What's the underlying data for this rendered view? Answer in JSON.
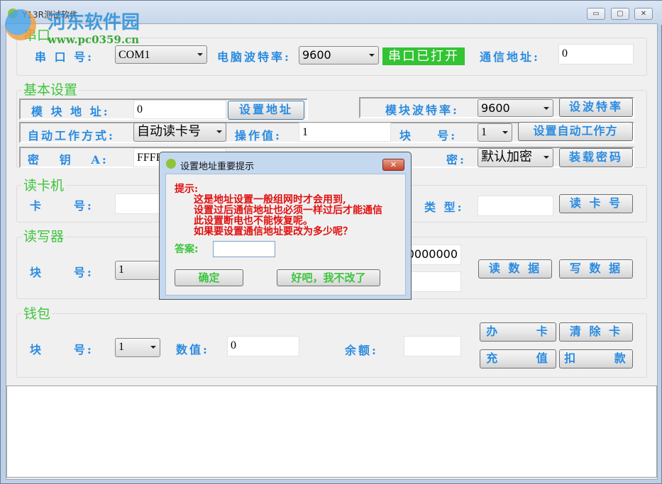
{
  "window": {
    "title": "Y13R测试软件",
    "controls": {
      "minimize": "▭",
      "maximize": "▢",
      "close": "✕"
    }
  },
  "watermark": {
    "name": "河东软件园",
    "url": "www.pc0359.cn"
  },
  "serial": {
    "legend": "串口",
    "port_label": "串 口 号:",
    "port_value": "COM1",
    "baud_label": "电脑波特率:",
    "baud_value": "9600",
    "status": "串口已打开",
    "status_color": "#33c333",
    "addr_label": "通信地址:",
    "addr_value": "0"
  },
  "basic": {
    "legend": "基本设置",
    "module_addr_label": "模 块 地 址:",
    "module_addr_value": "0",
    "set_addr_button": "设置地址",
    "module_baud_label": "模块波特率:",
    "module_baud_value": "9600",
    "set_baud_button": "设波特率",
    "auto_mode_label": "自动工作方式:",
    "auto_mode_value": "自动读卡号",
    "op_value_label": "操作值:",
    "op_value": "1",
    "block_label": "块    号:",
    "block_value": "1",
    "set_auto_button": "设置自动工作方",
    "key_label": "密   钥   A:",
    "key_value": "FFFF",
    "encrypt_label": "密:",
    "encrypt_value": "默认加密",
    "load_key_button": "装载密码"
  },
  "reader": {
    "legend": "读卡机",
    "card_label": "卡     号:",
    "card_value": "",
    "type_label": "类 型:",
    "type_value": "",
    "read_card_button": "读 卡 号"
  },
  "rw": {
    "legend": "读写器",
    "block_label": "块     号:",
    "block_value": "1",
    "data1": "0000000",
    "data2": "",
    "read_button": "读 数 据",
    "write_button": "写 数 据"
  },
  "wallet": {
    "legend": "钱包",
    "block_label": "块     号:",
    "block_value": "1",
    "amount_label": "数值:",
    "amount_value": "0",
    "balance_label": "余额:",
    "balance_value": "",
    "issue_button": "办      卡",
    "clear_button": "清 除 卡",
    "recharge_button": "充      值",
    "deduct_button": "扣      款"
  },
  "log": {
    "value": ""
  },
  "dialog": {
    "title": "设置地址重要提示",
    "close": "✕",
    "lines": [
      "提示:",
      "这是地址设置一般组网时才会用到,",
      "设置过后通信地址也必须一样过后才能通信",
      "此设置断电也不能恢复呢。",
      "如果要设置通信地址要改为多少呢？"
    ],
    "answer_label": "答案:",
    "answer_value": "",
    "ok_button": "确定",
    "cancel_button": "好吧，我不改了"
  }
}
